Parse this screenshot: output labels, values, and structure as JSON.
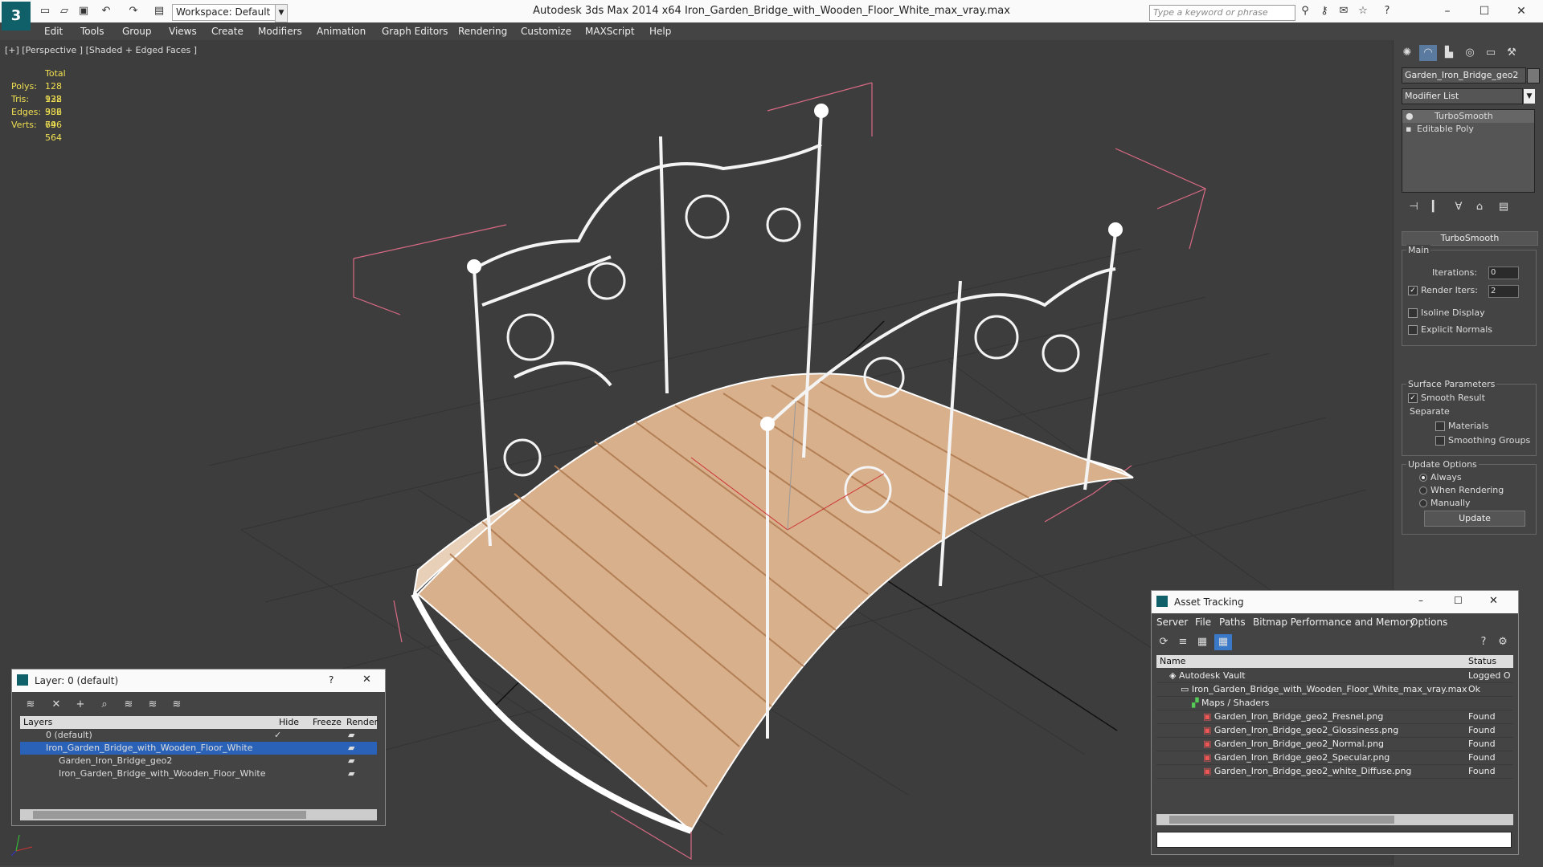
{
  "app": {
    "title": "Autodesk 3ds Max 2014 x64     Iron_Garden_Bridge_with_Wooden_Floor_White_max_vray.max",
    "workspace": "Workspace: Default",
    "search_placeholder": "Type a keyword or phrase"
  },
  "menu": [
    "Edit",
    "Tools",
    "Group",
    "Views",
    "Create",
    "Modifiers",
    "Animation",
    "Graph Editors",
    "Rendering",
    "Customize",
    "MAXScript",
    "Help"
  ],
  "viewport": {
    "label": "[+] [Perspective ] [Shaded + Edged Faces ]",
    "stats": {
      "header": "Total",
      "polys_label": "Polys:",
      "polys": "128 932",
      "tris_label": "Tris:",
      "tris": "128 932",
      "edges_label": "Edges:",
      "edges": "386 796",
      "verts_label": "Verts:",
      "verts": "64 564"
    }
  },
  "command_panel": {
    "object_name": "Garden_Iron_Bridge_geo2",
    "modifier_list": "Modifier List",
    "stack": [
      "TurboSmooth",
      "Editable Poly"
    ],
    "rollout": "TurboSmooth",
    "main_label": "Main",
    "iterations_label": "Iterations:",
    "iterations": "0",
    "render_iters_label": "Render Iters:",
    "render_iters": "2",
    "isoline": "Isoline Display",
    "explicit_normals": "Explicit Normals",
    "surface_params": "Surface Parameters",
    "smooth_result": "Smooth Result",
    "separate": "Separate",
    "materials": "Materials",
    "smoothing_groups": "Smoothing Groups",
    "update_options": "Update Options",
    "always": "Always",
    "when_rendering": "When Rendering",
    "manually": "Manually",
    "update_btn": "Update"
  },
  "layers_dialog": {
    "title": "Layer: 0 (default)",
    "help": "?",
    "cols": [
      "Layers",
      "Hide",
      "Freeze",
      "Render"
    ],
    "rows": [
      {
        "name": "0 (default)",
        "indent": 0
      },
      {
        "name": "Iron_Garden_Bridge_with_Wooden_Floor_White",
        "indent": 0,
        "selected": true
      },
      {
        "name": "Garden_Iron_Bridge_geo2",
        "indent": 1
      },
      {
        "name": "Iron_Garden_Bridge_with_Wooden_Floor_White",
        "indent": 1
      }
    ]
  },
  "asset_tracking": {
    "title": "Asset Tracking",
    "menu": [
      "Server",
      "File",
      "Paths",
      "Bitmap Performance and Memory",
      "Options"
    ],
    "cols": [
      "Name",
      "Status"
    ],
    "rows": [
      {
        "name": "Autodesk Vault",
        "status": "Logged O",
        "indent": 0
      },
      {
        "name": "Iron_Garden_Bridge_with_Wooden_Floor_White_max_vray.max",
        "status": "Ok",
        "indent": 1
      },
      {
        "name": "Maps / Shaders",
        "status": "",
        "indent": 2
      },
      {
        "name": "Garden_Iron_Bridge_geo2_Fresnel.png",
        "status": "Found",
        "indent": 3
      },
      {
        "name": "Garden_Iron_Bridge_geo2_Glossiness.png",
        "status": "Found",
        "indent": 3
      },
      {
        "name": "Garden_Iron_Bridge_geo2_Normal.png",
        "status": "Found",
        "indent": 3
      },
      {
        "name": "Garden_Iron_Bridge_geo2_Specular.png",
        "status": "Found",
        "indent": 3
      },
      {
        "name": "Garden_Iron_Bridge_geo2_white_Diffuse.png",
        "status": "Found",
        "indent": 3
      }
    ]
  }
}
